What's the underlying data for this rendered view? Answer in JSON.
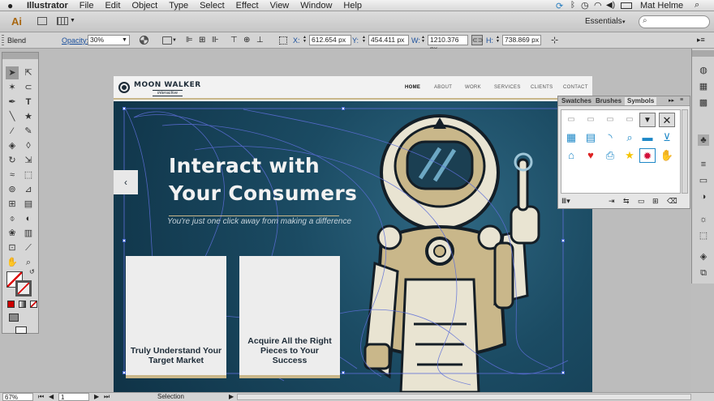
{
  "menubar": {
    "app_name": "Illustrator",
    "items": [
      "File",
      "Edit",
      "Object",
      "Type",
      "Select",
      "Effect",
      "View",
      "Window",
      "Help"
    ],
    "workspace": "Essentials",
    "user": "Mat Helme"
  },
  "appbar": {
    "logo": "Ai"
  },
  "control": {
    "mode": "Blend",
    "opacity_label": "Opacity:",
    "opacity_value": "30%",
    "x_label": "X:",
    "x_value": "612.654 px",
    "y_label": "Y:",
    "y_value": "454.411 px",
    "w_label": "W:",
    "w_value": "1210.376 px",
    "h_label": "H:",
    "h_value": "738.869 px"
  },
  "site": {
    "brand_name": "MOON WALKER",
    "brand_tagline": "interactive",
    "nav": [
      "HOME",
      "ABOUT",
      "WORK",
      "SERVICES",
      "CLIENTS",
      "CONTACT"
    ],
    "headline_1": "Interact with",
    "headline_2": "Your Consumers",
    "subhead": "You're just one click away from making a difference",
    "card_1_line_1": "Truly Understand Your",
    "card_1_line_2": "Target Market",
    "card_2_line_1": "Acquire All the Right",
    "card_2_line_2": "Pieces to Your Success"
  },
  "symbols_panel": {
    "tabs": [
      "Swatches",
      "Brushes",
      "Symbols"
    ],
    "active_tab": "Symbols"
  },
  "status": {
    "zoom": "67%",
    "artboard": "1",
    "tool": "Selection"
  },
  "colors": {
    "accent": "#c9b78a",
    "hero_dark": "#0f3347",
    "symbol_blue": "#1e88c7",
    "selection": "#4a6cd4"
  }
}
